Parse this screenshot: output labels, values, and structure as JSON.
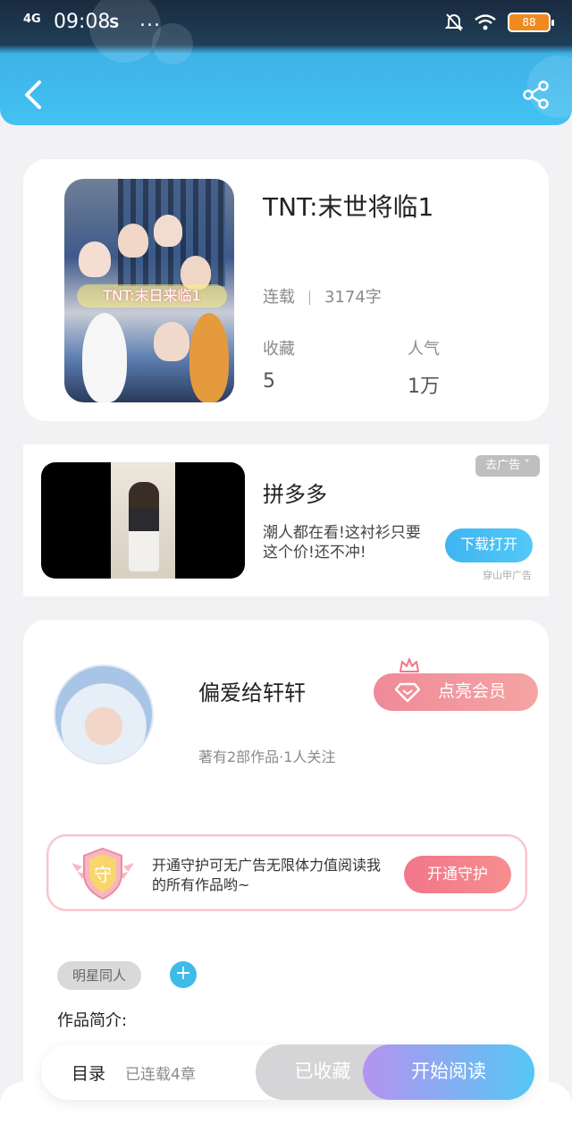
{
  "status_bar": {
    "signal": "4G",
    "time": "09:08",
    "app_icon": "S",
    "more": "...",
    "battery": "88"
  },
  "header": {
    "back_icon": "chevron-left-icon",
    "share_icon": "share-icon"
  },
  "book": {
    "cover_banner": "TNT:末日来临1",
    "title": "TNT:末世将临1",
    "status": "连载",
    "word_count": "3174字",
    "favorites_label": "收藏",
    "favorites_value": "5",
    "popularity_label": "人气",
    "popularity_value": "1万"
  },
  "ad": {
    "brand": "拼多多",
    "description": "潮人都在看!这衬衫只要这个价!还不冲!",
    "cta": "下载打开",
    "close_label": "去广告",
    "source": "穿山甲广告"
  },
  "author": {
    "name": "偏爱给轩轩",
    "summary": "著有2部作品·1人关注",
    "vip_label": "点亮会员",
    "guard_text": "开通守护可无广告无限体力值阅读我的所有作品哟~",
    "guard_button": "开通守护",
    "guard_badge": "守",
    "tag": "明星同人",
    "tag_add": "+",
    "intro_label": "作品简介:"
  },
  "bottom_bar": {
    "toc_label": "目录",
    "toc_count": "已连载4章",
    "collected_label": "已收藏",
    "read_label": "开始阅读"
  },
  "colors": {
    "header_blue": "#43c2f2",
    "accent_pink": "#f2768a",
    "read_gradient_start": "#b493f0",
    "read_gradient_end": "#55c7f4"
  }
}
